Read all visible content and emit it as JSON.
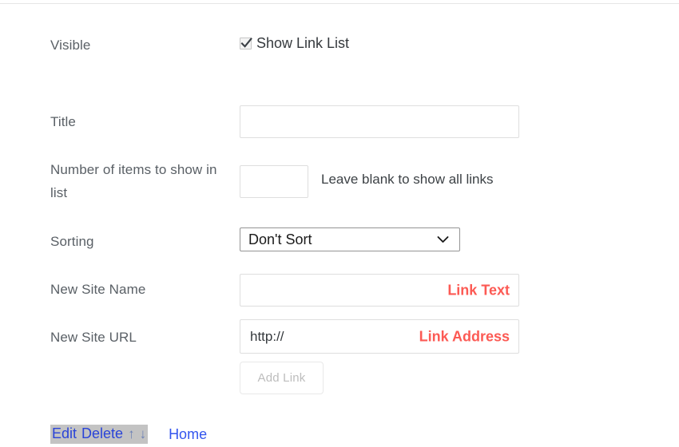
{
  "form": {
    "rows": [
      {
        "label": "Visible"
      },
      {
        "label": "Title"
      },
      {
        "label": "Number of items to show in list"
      },
      {
        "label": "Sorting"
      },
      {
        "label": "New Site Name"
      },
      {
        "label": "New Site URL"
      }
    ],
    "visible": {
      "label": "Visible",
      "checkbox_label": "Show Link List",
      "checked": true,
      "checkbox_icon": "checkmark-icon"
    },
    "title": {
      "label": "Title",
      "value": "",
      "placeholder": ""
    },
    "item_count": {
      "label": "Number of items to show in list",
      "value": "",
      "placeholder": "",
      "hint": "Leave blank to show all links"
    },
    "sorting": {
      "label": "Sorting",
      "selected": "Don't Sort",
      "arrow_icon": "chevron-down-icon"
    },
    "new_site_name": {
      "label": "New Site Name",
      "value": "",
      "placeholder": "Link Text"
    },
    "new_site_url": {
      "label": "New Site URL",
      "value": "http://",
      "placeholder": "Link Address"
    },
    "add_button": {
      "label": "Add Link",
      "disabled": true
    }
  },
  "footer": {
    "edit_label": "Edit",
    "delete_label": "Delete",
    "move_up_icon": "arrow-up-icon",
    "move_up_label": "↑",
    "move_down_icon": "arrow-down-icon",
    "move_down_label": "↓",
    "home_label": "Home"
  },
  "colors": {
    "link_blue": "#2a44d8",
    "home_blue": "#3355ee",
    "placeholder_red": "#fc5a54",
    "selection_gray": "#c3c3c3",
    "label_gray": "#5a6066",
    "input_border": "#dedede",
    "select_border": "#949494",
    "disabled_text": "#bdbdbd"
  }
}
